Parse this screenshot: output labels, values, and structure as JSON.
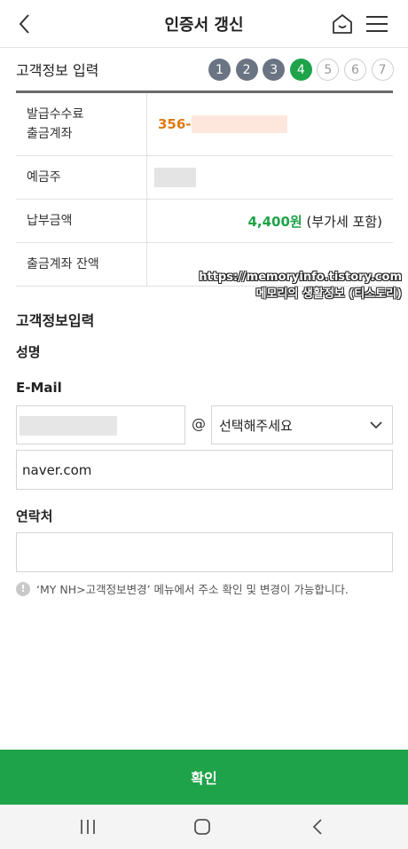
{
  "header": {
    "title": "인증서 갱신",
    "back_icon": "chevron-left-icon",
    "home_icon": "home-icon",
    "menu_icon": "hamburger-menu-icon"
  },
  "stepbar": {
    "title": "고객정보 입력",
    "steps": [
      {
        "label": "1",
        "state": "done"
      },
      {
        "label": "2",
        "state": "done"
      },
      {
        "label": "3",
        "state": "done"
      },
      {
        "label": "4",
        "state": "active"
      },
      {
        "label": "5",
        "state": "todo"
      },
      {
        "label": "6",
        "state": "todo"
      },
      {
        "label": "7",
        "state": "todo"
      }
    ]
  },
  "info_table": {
    "rows": [
      {
        "label_line1": "발급수수료",
        "label_line2": "출금계좌",
        "value": "356-"
      },
      {
        "label": "예금주"
      },
      {
        "label": "납부금액",
        "amount": "4,400원",
        "note": "(부가세 포함)"
      },
      {
        "label": "출금계좌 잔액"
      }
    ]
  },
  "watermark": {
    "line1": "https://memoryinfo.tistory.com",
    "line2": "메모리의 생활정보 (티스토리)"
  },
  "form": {
    "section_title": "고객정보입력",
    "name_label": "성명",
    "email_label": "E-Mail",
    "at_sign": "@",
    "domain_select": "선택해주세요",
    "domain_value": "naver.com",
    "phone_label": "연락처"
  },
  "notice": {
    "icon": "exclamation-circle-icon",
    "text": "‘MY NH>고객정보변경’ 메뉴에서 주소 확인 및 변경이 가능합니다."
  },
  "confirm_button": "확인",
  "navbar": {
    "recent_icon": "recent-apps-icon",
    "home_icon": "home-square-icon",
    "back_icon": "back-icon"
  },
  "colors": {
    "accent_green": "#1fa34a",
    "step_done": "#6b7483",
    "account_orange": "#e07a12"
  }
}
